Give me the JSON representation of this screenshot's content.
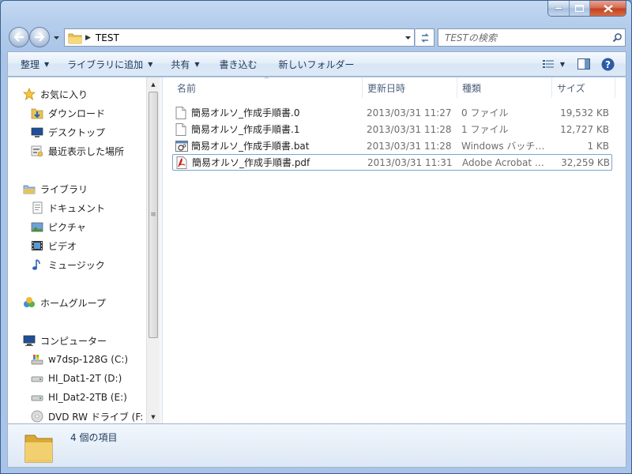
{
  "address": {
    "path": "TEST"
  },
  "search": {
    "placeholder": "TESTの検索"
  },
  "toolbar": {
    "organize": "整理",
    "library": "ライブラリに追加",
    "share": "共有",
    "burn": "書き込む",
    "new_folder": "新しいフォルダー"
  },
  "sidebar": {
    "favorites": {
      "label": "お気に入り",
      "items": [
        "ダウンロード",
        "デスクトップ",
        "最近表示した場所"
      ]
    },
    "libraries": {
      "label": "ライブラリ",
      "items": [
        "ドキュメント",
        "ピクチャ",
        "ビデオ",
        "ミュージック"
      ]
    },
    "homegroup": {
      "label": "ホームグループ"
    },
    "computer": {
      "label": "コンピューター",
      "items": [
        "w7dsp-128G (C:)",
        "HI_Dat1-2T (D:)",
        "HI_Dat2-2TB (E:)",
        "DVD RW ドライブ (F:"
      ]
    }
  },
  "columns": {
    "name": "名前",
    "date": "更新日時",
    "type": "種類",
    "size": "サイズ"
  },
  "files": [
    {
      "name": "簡易オルソ_作成手順書.0",
      "date": "2013/03/31 11:27",
      "type": "0 ファイル",
      "size": "19,532 KB",
      "icon": "blank-file-icon"
    },
    {
      "name": "簡易オルソ_作成手順書.1",
      "date": "2013/03/31 11:28",
      "type": "1 ファイル",
      "size": "12,727 KB",
      "icon": "blank-file-icon"
    },
    {
      "name": "簡易オルソ_作成手順書.bat",
      "date": "2013/03/31 11:28",
      "type": "Windows バッチ…",
      "size": "1 KB",
      "icon": "batch-file-icon"
    },
    {
      "name": "簡易オルソ_作成手順書.pdf",
      "date": "2013/03/31 11:31",
      "type": "Adobe Acrobat …",
      "size": "32,259 KB",
      "icon": "pdf-file-icon"
    }
  ],
  "status": {
    "count": "4 個の項目"
  },
  "colors": {
    "accent": "#1e395b",
    "selection_border": "#7da2ce"
  }
}
